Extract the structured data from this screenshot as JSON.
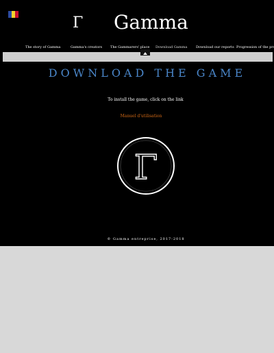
{
  "header": {
    "logo_letter": "Γ",
    "title": "Gamma"
  },
  "language_flag": {
    "name": "french-flag",
    "colors": [
      "#2b4aa3",
      "#f2d22e",
      "#c8102e"
    ]
  },
  "nav": {
    "items": [
      {
        "label": "The story of Gamma"
      },
      {
        "label": "Gamma's creators"
      },
      {
        "label": "The Gammarers' place"
      },
      {
        "label": "Download Gamma"
      },
      {
        "label": "Download our reports"
      },
      {
        "label": "Progression of the project"
      }
    ],
    "active_label": "Download Gamma"
  },
  "main": {
    "heading": "DOWNLOAD THE GAME",
    "install_text": "To install the game, click on the link",
    "manual_link": "Manuel d'utilisation",
    "emblem_letter": "Γ"
  },
  "footer": {
    "copyright": "© Gamma entreprise, 2017-2018"
  },
  "colors": {
    "background": "#000000",
    "outer": "#d8d8d8",
    "heading": "#4a86c9",
    "link": "#d46a16"
  }
}
